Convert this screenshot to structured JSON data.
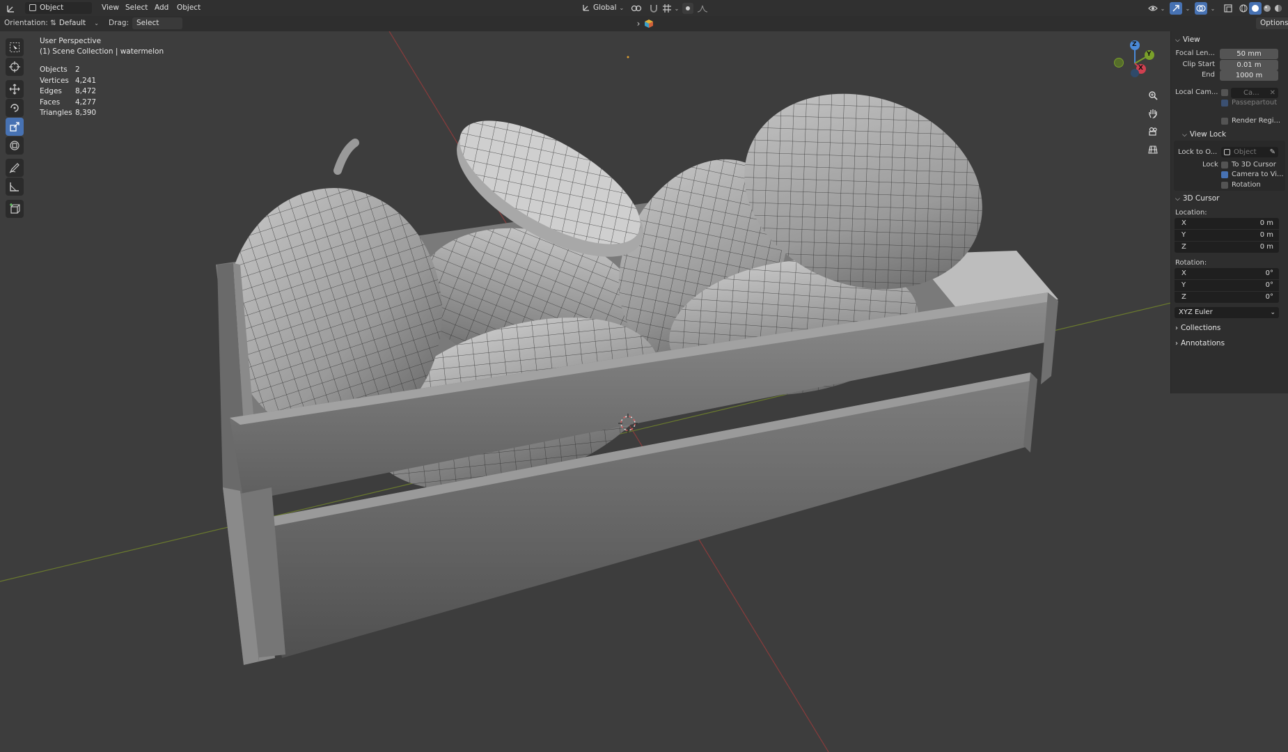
{
  "header": {
    "mode_label": "Object Mode",
    "menus": [
      "View",
      "Select",
      "Add",
      "Object"
    ],
    "transform_orientation": "Global"
  },
  "toolsettings": {
    "orientation_label": "Orientation:",
    "orientation_value": "Default",
    "drag_label": "Drag:",
    "drag_value": "Select Box",
    "options_label": "Options"
  },
  "viewport": {
    "perspective": "User Perspective",
    "collection": "(1) Scene Collection | watermelon",
    "stats": [
      {
        "label": "Objects",
        "value": "2"
      },
      {
        "label": "Vertices",
        "value": "4,241"
      },
      {
        "label": "Edges",
        "value": "8,472"
      },
      {
        "label": "Faces",
        "value": "4,277"
      },
      {
        "label": "Triangles",
        "value": "8,390"
      }
    ],
    "gizmo_axes": {
      "x": "X",
      "y": "Y",
      "z": "Z"
    }
  },
  "npanel": {
    "view_title": "View",
    "focal_label": "Focal Len...",
    "focal_value": "50 mm",
    "clip_start_label": "Clip Start",
    "clip_start_value": "0.01 m",
    "end_label": "End",
    "end_value": "1000 m",
    "local_cam_label": "Local Cam...",
    "local_cam_value": "Ca...",
    "passepartout_label": "Passepartout",
    "render_region_label": "Render Regi...",
    "view_lock_title": "View Lock",
    "lock_to_label": "Lock to O...",
    "lock_to_value": "Object",
    "lock_label": "Lock",
    "to_cursor_label": "To 3D Cursor",
    "camera_to_view_label": "Camera to Vi...",
    "rotation_label": "Rotation",
    "cursor_title": "3D Cursor",
    "location_label": "Location:",
    "location": [
      {
        "axis": "X",
        "value": "0 m"
      },
      {
        "axis": "Y",
        "value": "0 m"
      },
      {
        "axis": "Z",
        "value": "0 m"
      }
    ],
    "rotation_section_label": "Rotation:",
    "rotation": [
      {
        "axis": "X",
        "value": "0°"
      },
      {
        "axis": "Y",
        "value": "0°"
      },
      {
        "axis": "Z",
        "value": "0°"
      }
    ],
    "rotation_mode": "XYZ Euler",
    "collections_title": "Collections",
    "annotations_title": "Annotations"
  }
}
